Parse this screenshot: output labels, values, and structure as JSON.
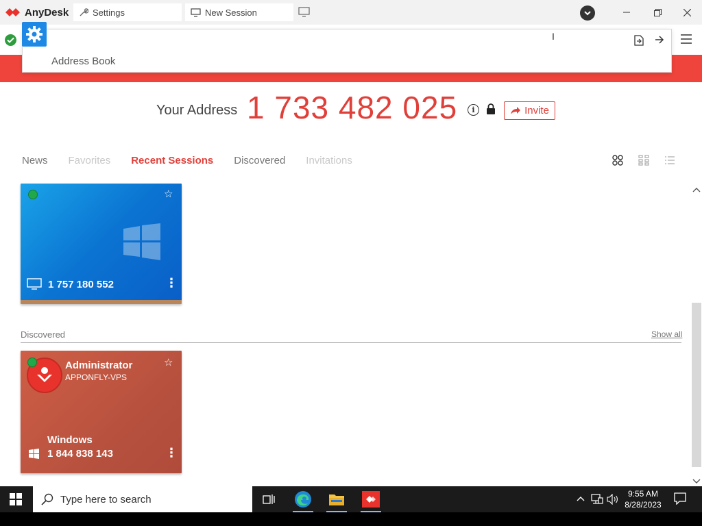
{
  "titlebar": {
    "app_name": "AnyDesk",
    "tabs": [
      {
        "label": "Settings",
        "icon": "wrench-icon"
      },
      {
        "label": "New Session",
        "icon": "monitor-icon"
      }
    ]
  },
  "dropdown": {
    "item_label": "Address Book"
  },
  "address": {
    "label": "Your Address",
    "value": "1 733 482 025",
    "invite_label": "Invite"
  },
  "nav_tabs": [
    {
      "label": "News",
      "state": "normal"
    },
    {
      "label": "Favorites",
      "state": "disabled"
    },
    {
      "label": "Recent Sessions",
      "state": "active"
    },
    {
      "label": "Discovered",
      "state": "normal"
    },
    {
      "label": "Invitations",
      "state": "disabled"
    }
  ],
  "recent_sessions": [
    {
      "id": "1 757 180 552",
      "online": true
    }
  ],
  "discovered_section": {
    "title": "Discovered",
    "show_all": "Show all",
    "items": [
      {
        "name": "Administrator",
        "host": "APPONFLY-VPS",
        "os": "Windows",
        "id": "1 844 838 143",
        "online": true
      }
    ]
  },
  "taskbar": {
    "search_placeholder": "Type here to search",
    "time": "9:55 AM",
    "date": "8/28/2023"
  },
  "colors": {
    "accent": "#e0403a",
    "red_band": "#ef443b",
    "gear_tile": "#1e88e5",
    "online": "#20a84a"
  }
}
